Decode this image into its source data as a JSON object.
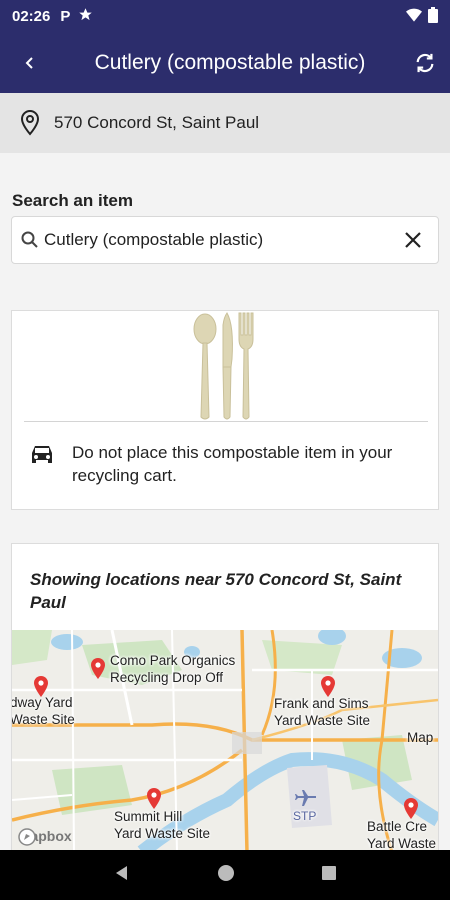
{
  "status_bar": {
    "time": "02:26",
    "parking_icon": "P"
  },
  "header": {
    "title": "Cutlery (compostable plastic)"
  },
  "address": {
    "text": "570 Concord St, Saint Paul"
  },
  "search": {
    "label": "Search an item",
    "value": "Cutlery (compostable plastic)"
  },
  "item_card": {
    "instruction": "Do not place this compostable item in your recycling cart."
  },
  "locations": {
    "heading": "Showing locations near 570 Concord St, Saint Paul",
    "map_labels": {
      "como_park": "Como Park Organics Recycling Drop Off",
      "como_park_line1": "Como Park Organics",
      "como_park_line2": "Recycling Drop Off",
      "ridway_line1": "dway Yard",
      "ridway_line2": "Waste Site",
      "frank_sims_line1": "Frank and Sims",
      "frank_sims_line2": "Yard Waste Site",
      "map_edge": "Map",
      "summit_line1": "Summit Hill",
      "summit_line2": "Yard Waste Site",
      "stp": "STP",
      "battle_line1": "Battle Cre",
      "battle_line2": "Yard Waste",
      "mapbox": "mapbox"
    }
  },
  "colors": {
    "primary": "#2c2d6c",
    "pin": "#e53935"
  }
}
